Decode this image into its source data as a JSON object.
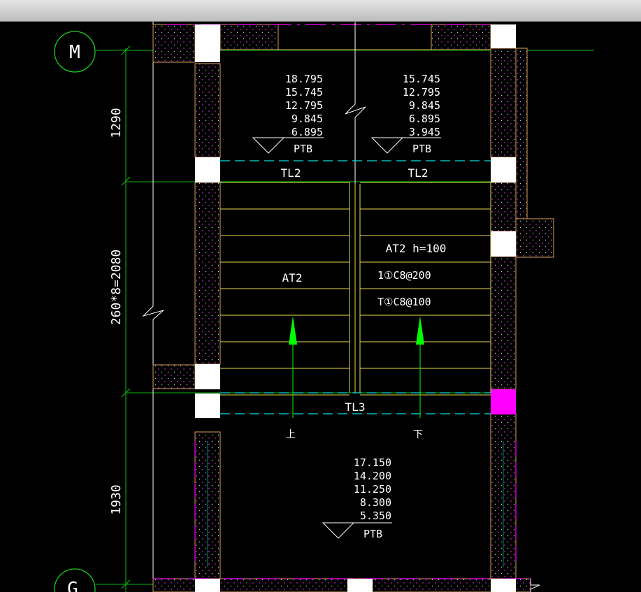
{
  "axes": {
    "top": "M",
    "bottom": "G"
  },
  "dimensions": [
    "1290",
    "260*8=2080",
    "1930"
  ],
  "landings": [
    {
      "levels": [
        "18.795",
        "15.745",
        "12.795",
        "9.845",
        "6.895"
      ],
      "label": "PTB"
    },
    {
      "levels": [
        "15.745",
        "12.795",
        "9.845",
        "6.895",
        "3.945"
      ],
      "label": "PTB"
    },
    {
      "levels": [
        "17.150",
        "14.200",
        "11.250",
        "8.300",
        "5.350"
      ],
      "label": "PTB"
    }
  ],
  "beams": {
    "tl2_left": "TL2",
    "tl2_right": "TL2",
    "tl3": "TL3"
  },
  "stairs": {
    "left_label": "AT2",
    "right_label": "AT2 h=100",
    "rebar_top": "1①C8@200",
    "rebar_bottom": "T①C8@100",
    "up_label": "上",
    "down_label": "下"
  },
  "colors": {
    "background": "#000000",
    "wall": "#d9a05b",
    "stair_line": "#e6d94a",
    "dimension": "#00e000",
    "beam": "#00e0e0",
    "opening": "#ff00ff",
    "text": "#ffffff",
    "arrow": "#00ff00"
  }
}
